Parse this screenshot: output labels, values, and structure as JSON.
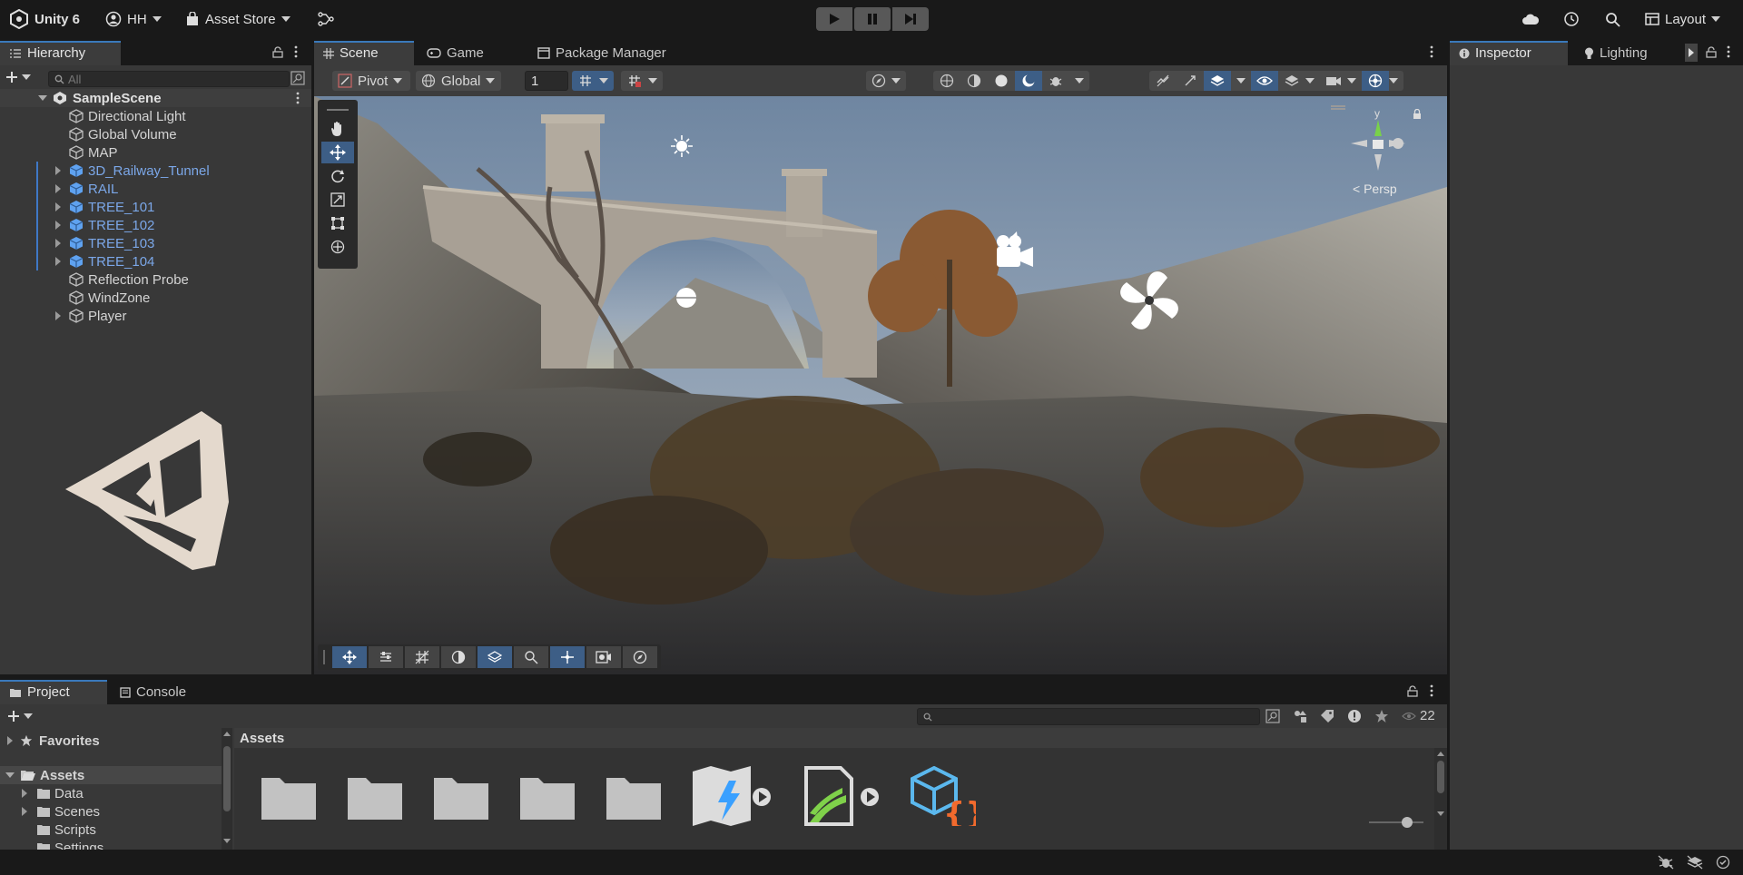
{
  "topbar": {
    "app_title": "Unity 6",
    "account": "HH",
    "asset_store": "Asset Store",
    "layout": "Layout"
  },
  "hierarchy": {
    "tab_label": "Hierarchy",
    "search_placeholder": "All",
    "scene_name": "SampleScene",
    "items": [
      {
        "label": "Directional Light",
        "prefab": false,
        "expandable": false
      },
      {
        "label": "Global Volume",
        "prefab": false,
        "expandable": false
      },
      {
        "label": "MAP",
        "prefab": false,
        "expandable": false
      },
      {
        "label": "3D_Railway_Tunnel",
        "prefab": true,
        "expandable": true
      },
      {
        "label": "RAIL",
        "prefab": true,
        "expandable": true
      },
      {
        "label": "TREE_101",
        "prefab": true,
        "expandable": true
      },
      {
        "label": "TREE_102",
        "prefab": true,
        "expandable": true
      },
      {
        "label": "TREE_103",
        "prefab": true,
        "expandable": true
      },
      {
        "label": "TREE_104",
        "prefab": true,
        "expandable": true
      },
      {
        "label": "Reflection Probe",
        "prefab": false,
        "expandable": false
      },
      {
        "label": "WindZone",
        "prefab": false,
        "expandable": false
      },
      {
        "label": "Player",
        "prefab": false,
        "expandable": true
      }
    ]
  },
  "scene": {
    "tabs": [
      "Scene",
      "Game",
      "Package Manager"
    ],
    "pivot": "Pivot",
    "global": "Global",
    "grid_size": "1",
    "persp_label": "< Persp",
    "gizmo_axis": "y"
  },
  "inspector": {
    "tabs": [
      "Inspector",
      "Lighting"
    ]
  },
  "project": {
    "tabs": [
      "Project",
      "Console"
    ],
    "favorites": "Favorites",
    "assets": "Assets",
    "folders": [
      "Data",
      "Scenes",
      "Scripts",
      "Settings"
    ],
    "breadcrumb": "Assets",
    "visible_count": "22"
  },
  "colors": {
    "accent_blue": "#3a79bb",
    "prefab_text": "#7ba7e8",
    "panel_bg": "#383838",
    "chrome_bg": "#191919"
  }
}
